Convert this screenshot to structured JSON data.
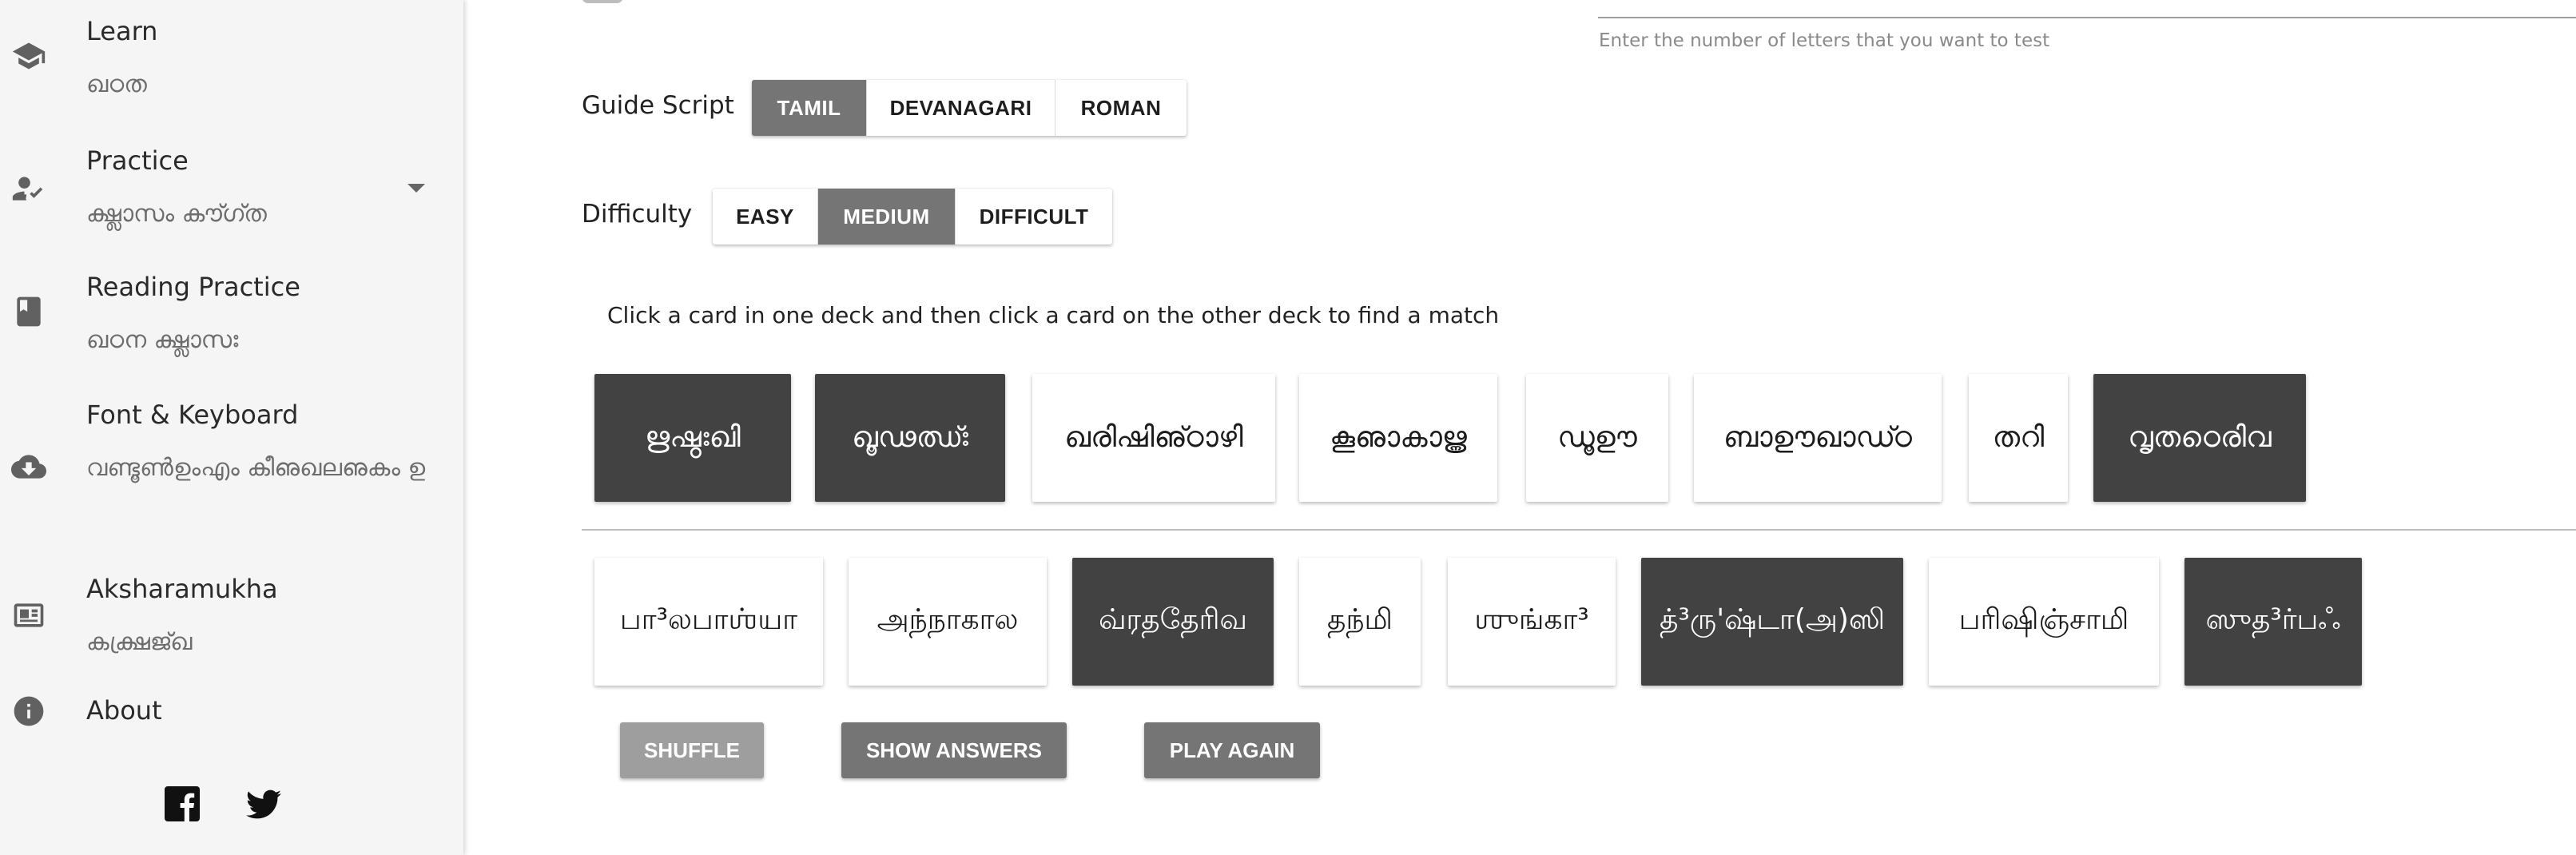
{
  "sidebar": {
    "items": [
      {
        "title": "Learn",
        "subtitle": "ഖഠത",
        "icon": "school-icon"
      },
      {
        "title": "Practice",
        "subtitle": "ക്ഷ്ലാസം കൗ്ഗ്ത",
        "icon": "person-check-icon"
      },
      {
        "title": "Reading Practice",
        "subtitle": "ഖഠന ക്ഷ്ലാസഃ",
        "icon": "book-icon"
      },
      {
        "title": "Font & Keyboard",
        "subtitle": "വണ്ടൂൺഉംഎം കീഌഖലഌകം ഉ",
        "icon": "cloud-download-icon"
      },
      {
        "title": "Aksharamukha",
        "subtitle": "കക്ഷ്രജ്ഖ",
        "icon": "newspaper-icon"
      },
      {
        "title": "About",
        "icon": "info-icon"
      }
    ],
    "social": [
      "facebook-icon",
      "twitter-icon"
    ]
  },
  "letters_hint": "Enter the number of letters that you want to test",
  "guide_script": {
    "label": "Guide Script",
    "options": [
      "TAMIL",
      "DEVANAGARI",
      "ROMAN"
    ],
    "selected": "TAMIL"
  },
  "difficulty": {
    "label": "Difficulty",
    "options": [
      "EASY",
      "MEDIUM",
      "DIFFICULT"
    ],
    "selected": "MEDIUM"
  },
  "instructions": "Click a card in one deck and then click a card on the other deck to find a match",
  "deck_top": [
    {
      "text": "ഋഷ്ഠഃഖി",
      "selected": true
    },
    {
      "text": "ഖൂഢഝ്ഃ",
      "selected": true
    },
    {
      "text": "ഖരിഷിഌ്ഠാഴി",
      "selected": false
    },
    {
      "text": "കൂഌാകാൠ",
      "selected": false
    },
    {
      "text": "ഡൂഊ",
      "selected": false
    },
    {
      "text": "ബാഊഖാഡ്ഠ",
      "selected": false
    },
    {
      "text": "തറി",
      "selected": false
    },
    {
      "text": "വൃതഠെരിവ",
      "selected": true
    }
  ],
  "deck_bottom": [
    {
      "text": "பா³லபாஶ்யா",
      "selected": false
    },
    {
      "text": "அந்நாகால",
      "selected": false
    },
    {
      "text": "வ்ரததேரிவ",
      "selected": true
    },
    {
      "text": "தந்மி",
      "selected": false
    },
    {
      "text": "ஶுங்கா³",
      "selected": false
    },
    {
      "text": "த்³ரு'ஷ்டா(அ)ஸி",
      "selected": true
    },
    {
      "text": "பரிஷிஞ்சாமி",
      "selected": false
    },
    {
      "text": "ஸுத³ர்பஃ",
      "selected": true
    }
  ],
  "actions": {
    "shuffle": "SHUFFLE",
    "show_answers": "SHOW ANSWERS",
    "play_again": "PLAY AGAIN"
  },
  "colors": {
    "sidebar_bg": "#f5f5f5",
    "active_segment": "#757575",
    "selected_card": "#424242",
    "shuffle_btn": "#9e9e9e",
    "action_btn": "#757575"
  }
}
